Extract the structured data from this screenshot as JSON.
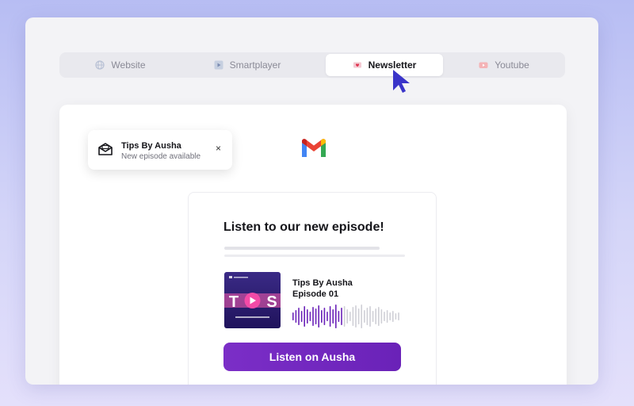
{
  "tabs": [
    {
      "label": "Website",
      "icon": "globe-icon"
    },
    {
      "label": "Smartplayer",
      "icon": "play-square-icon"
    },
    {
      "label": "Newsletter",
      "icon": "heart-mail-icon"
    },
    {
      "label": "Youtube",
      "icon": "youtube-icon"
    }
  ],
  "active_tab": "Newsletter",
  "notification": {
    "title": "Tips By Ausha",
    "subtitle": "New episode available",
    "close": "×"
  },
  "email": {
    "heading": "Listen to our new episode!",
    "episode_show": "Tips By Ausha",
    "episode_number": "Episode 01",
    "button_label": "Listen on Ausha"
  },
  "colors": {
    "accent": "#7b2ec7",
    "background": "#b7bdf3",
    "cursor": "#3a34c9"
  }
}
